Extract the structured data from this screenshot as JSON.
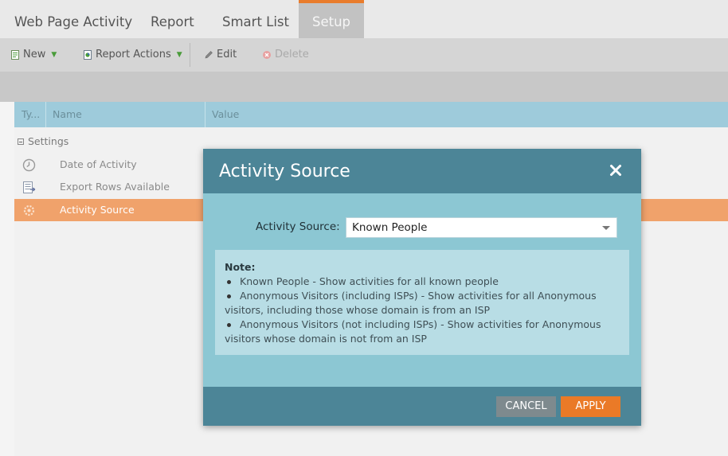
{
  "tabs": [
    {
      "label": "Web Page Activity"
    },
    {
      "label": "Report"
    },
    {
      "label": "Smart List"
    },
    {
      "label": "Setup"
    }
  ],
  "toolbar": {
    "new_label": "New",
    "report_actions_label": "Report Actions",
    "edit_label": "Edit",
    "delete_label": "Delete"
  },
  "grid": {
    "columns": [
      "Ty...",
      "Name",
      "Value"
    ],
    "group_label": "Settings",
    "rows": [
      {
        "label": "Date of Activity",
        "icon": "clock-icon"
      },
      {
        "label": "Export Rows Available",
        "icon": "export-rows-icon"
      },
      {
        "label": "Activity Source",
        "icon": "gear-icon"
      }
    ]
  },
  "modal": {
    "title": "Activity Source",
    "field_label": "Activity Source:",
    "field_value": "Known People",
    "note_title": "Note:",
    "note_items": [
      "Known People - Show activities for all known people",
      "Anonymous Visitors (including ISPs) - Show activities for all Anonymous visitors, including those whose domain is from an ISP",
      "Anonymous Visitors (not including ISPs) - Show activities for Anonymous visitors whose domain is not from an ISP"
    ],
    "cancel_label": "CANCEL",
    "apply_label": "APPLY"
  },
  "colors": {
    "accent": "#ea7a27",
    "modal_header": "#4c8597",
    "modal_body": "#8cc7d3",
    "selected_row": "#f0a26b"
  }
}
